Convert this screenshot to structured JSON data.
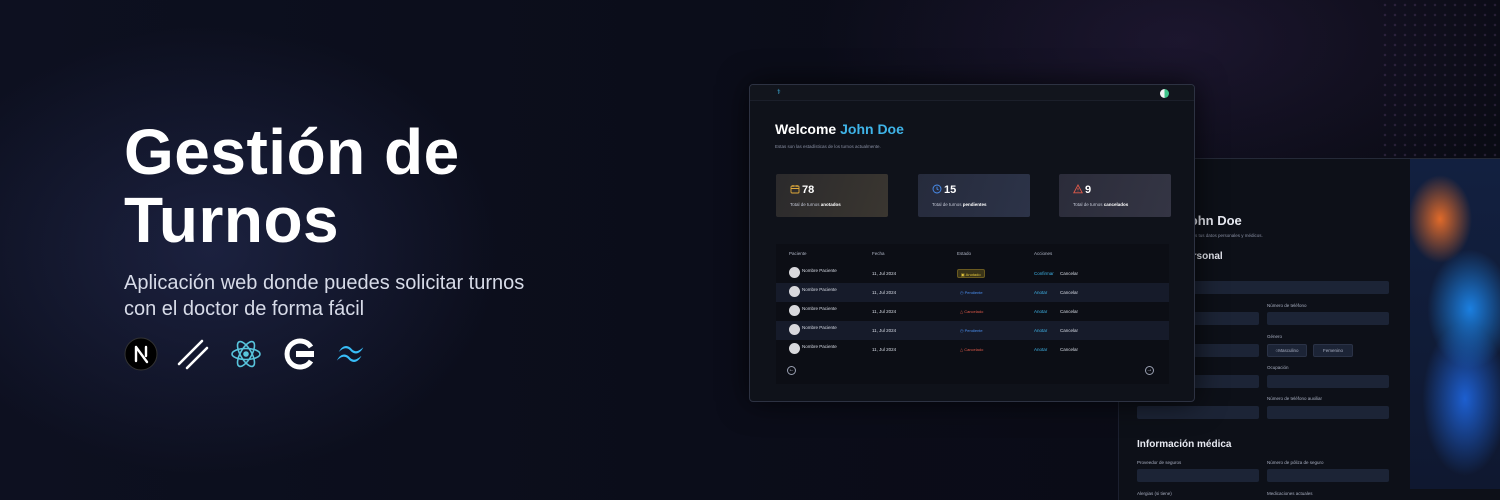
{
  "hero": {
    "title_line1": "Gestión de",
    "title_line2": "Turnos",
    "subtitle_line1": "Aplicación web donde puedes solicitar turnos",
    "subtitle_line2": "con el doctor de forma fácil"
  },
  "tech_icons": [
    "nextjs-icon",
    "shadcn-icon",
    "react-icon",
    "clerk-icon",
    "tailwind-icon"
  ],
  "dashboard": {
    "welcome": "Welcome",
    "user_name": "John Doe",
    "description": "Estas son las estadísticas de los turnos actualmente.",
    "stats": [
      {
        "number": "78",
        "label_prefix": "Total de turnos",
        "label_strong": "anotados",
        "icon": "calendar-icon",
        "color": "#e0a93a"
      },
      {
        "number": "15",
        "label_prefix": "Total de turnos",
        "label_strong": "pendientes",
        "icon": "clock-icon",
        "color": "#4a8ff0"
      },
      {
        "number": "9",
        "label_prefix": "Total de turnos",
        "label_strong": "cancelados",
        "icon": "warning-icon",
        "color": "#e05a4a"
      }
    ],
    "table": {
      "headers": [
        "Paciente",
        "Fecha",
        "Estado",
        "Acciones"
      ],
      "rows": [
        {
          "patient": "Nombre Paciente",
          "date": "11, Jul 2024",
          "status": "Anotado",
          "action1": "Confirmar",
          "action2": "Cancelar"
        },
        {
          "patient": "Nombre Paciente",
          "date": "11, Jul 2024",
          "status": "Pendiente",
          "action1": "Anotar",
          "action2": "Cancelar"
        },
        {
          "patient": "Nombre Paciente",
          "date": "11, Jul 2024",
          "status": "Cancelado",
          "action1": "Anotar",
          "action2": "Cancelar"
        },
        {
          "patient": "Nombre Paciente",
          "date": "11, Jul 2024",
          "status": "Pendiente",
          "action1": "Anotar",
          "action2": "Cancelar"
        },
        {
          "patient": "Nombre Paciente",
          "date": "11, Jul 2024",
          "status": "Cancelado",
          "action1": "Anotar",
          "action2": "Cancelar"
        }
      ],
      "prev": "←",
      "next": "→"
    }
  },
  "form": {
    "title": "o John Doe",
    "description": "ar todos tus datos personales y médicos.",
    "section_personal": "personal",
    "phone_label": "Número de teléfono",
    "gender_label": "Género",
    "gender_male": "Masculino",
    "gender_female": "Femenino",
    "occupation_label": "Ocupación",
    "aux_phone_label": "Número de teléfono auxiliar",
    "section_medical": "Información médica",
    "insurance_label": "Proveedor de seguros",
    "policy_label": "Número de póliza de seguro",
    "allergies_label": "Alergias (si tiene)",
    "medications_label": "Medicaciones actuales"
  },
  "colors": {
    "accent": "#3fb4e8",
    "anotado": "#e0c23a",
    "pendiente": "#4a8ff0",
    "cancelado": "#e05a4a"
  }
}
